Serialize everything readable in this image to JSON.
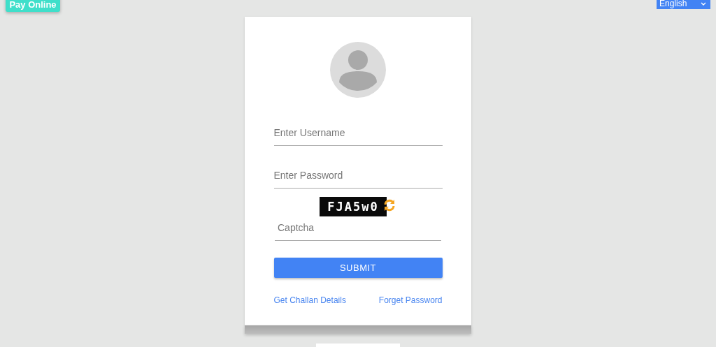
{
  "pay_button": {
    "label": "Pay Online"
  },
  "language_select": {
    "value": "English"
  },
  "login": {
    "username": {
      "placeholder": "Enter Username"
    },
    "password": {
      "placeholder": "Enter Password"
    },
    "captcha": {
      "code": "FJA5w0",
      "input": {
        "placeholder": "Captcha"
      }
    },
    "submit": "SUBMIT",
    "links": [
      "Get Challan Details",
      "Forget Password"
    ]
  }
}
